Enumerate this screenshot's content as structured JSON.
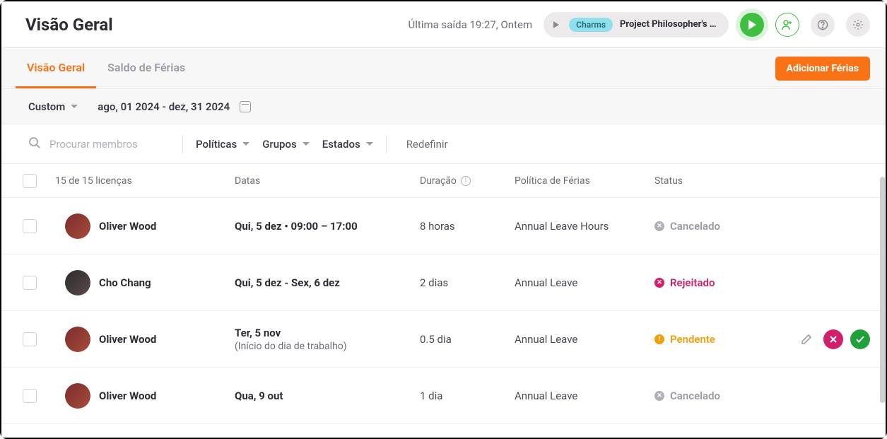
{
  "header": {
    "title": "Visão Geral",
    "last_exit": "Última saída 19:27, Ontem",
    "tag": "Charms",
    "project": "Project Philosopher's St..."
  },
  "tabs": {
    "overview": "Visão Geral",
    "balance": "Saldo de Férias",
    "add_button": "Adicionar Férias"
  },
  "date_filter": {
    "mode": "Custom",
    "range": "ago, 01 2024 - dez, 31 2024"
  },
  "filters": {
    "search_placeholder": "Procurar membros",
    "policies": "Políticas",
    "groups": "Grupos",
    "states": "Estados",
    "reset": "Redefinir"
  },
  "table": {
    "count": "15 de 15 licenças",
    "headers": {
      "dates": "Datas",
      "duration": "Duração",
      "policy": "Política de Férias",
      "status": "Status"
    },
    "rows": [
      {
        "member": "Oliver Wood",
        "avatar": "oliver",
        "dates": "Qui, 5 dez • 09:00 – 17:00",
        "dates_sub": "",
        "duration": "8 horas",
        "policy": "Annual Leave Hours",
        "status_key": "cancel",
        "status": "Cancelado",
        "actions": false
      },
      {
        "member": "Cho Chang",
        "avatar": "cho",
        "dates": "Qui, 5 dez - Sex, 6 dez",
        "dates_sub": "",
        "duration": "2 dias",
        "policy": "Annual Leave",
        "status_key": "reject",
        "status": "Rejeitado",
        "actions": false
      },
      {
        "member": "Oliver Wood",
        "avatar": "oliver",
        "dates": "Ter, 5 nov",
        "dates_sub": "(Início do dia de trabalho)",
        "duration": "0.5 dia",
        "policy": "Annual Leave",
        "status_key": "pending",
        "status": "Pendente",
        "actions": true
      },
      {
        "member": "Oliver Wood",
        "avatar": "oliver",
        "dates": "Qua, 9 out",
        "dates_sub": "",
        "duration": "1 dia",
        "policy": "Annual Leave",
        "status_key": "cancel",
        "status": "Cancelado",
        "actions": false
      }
    ]
  }
}
